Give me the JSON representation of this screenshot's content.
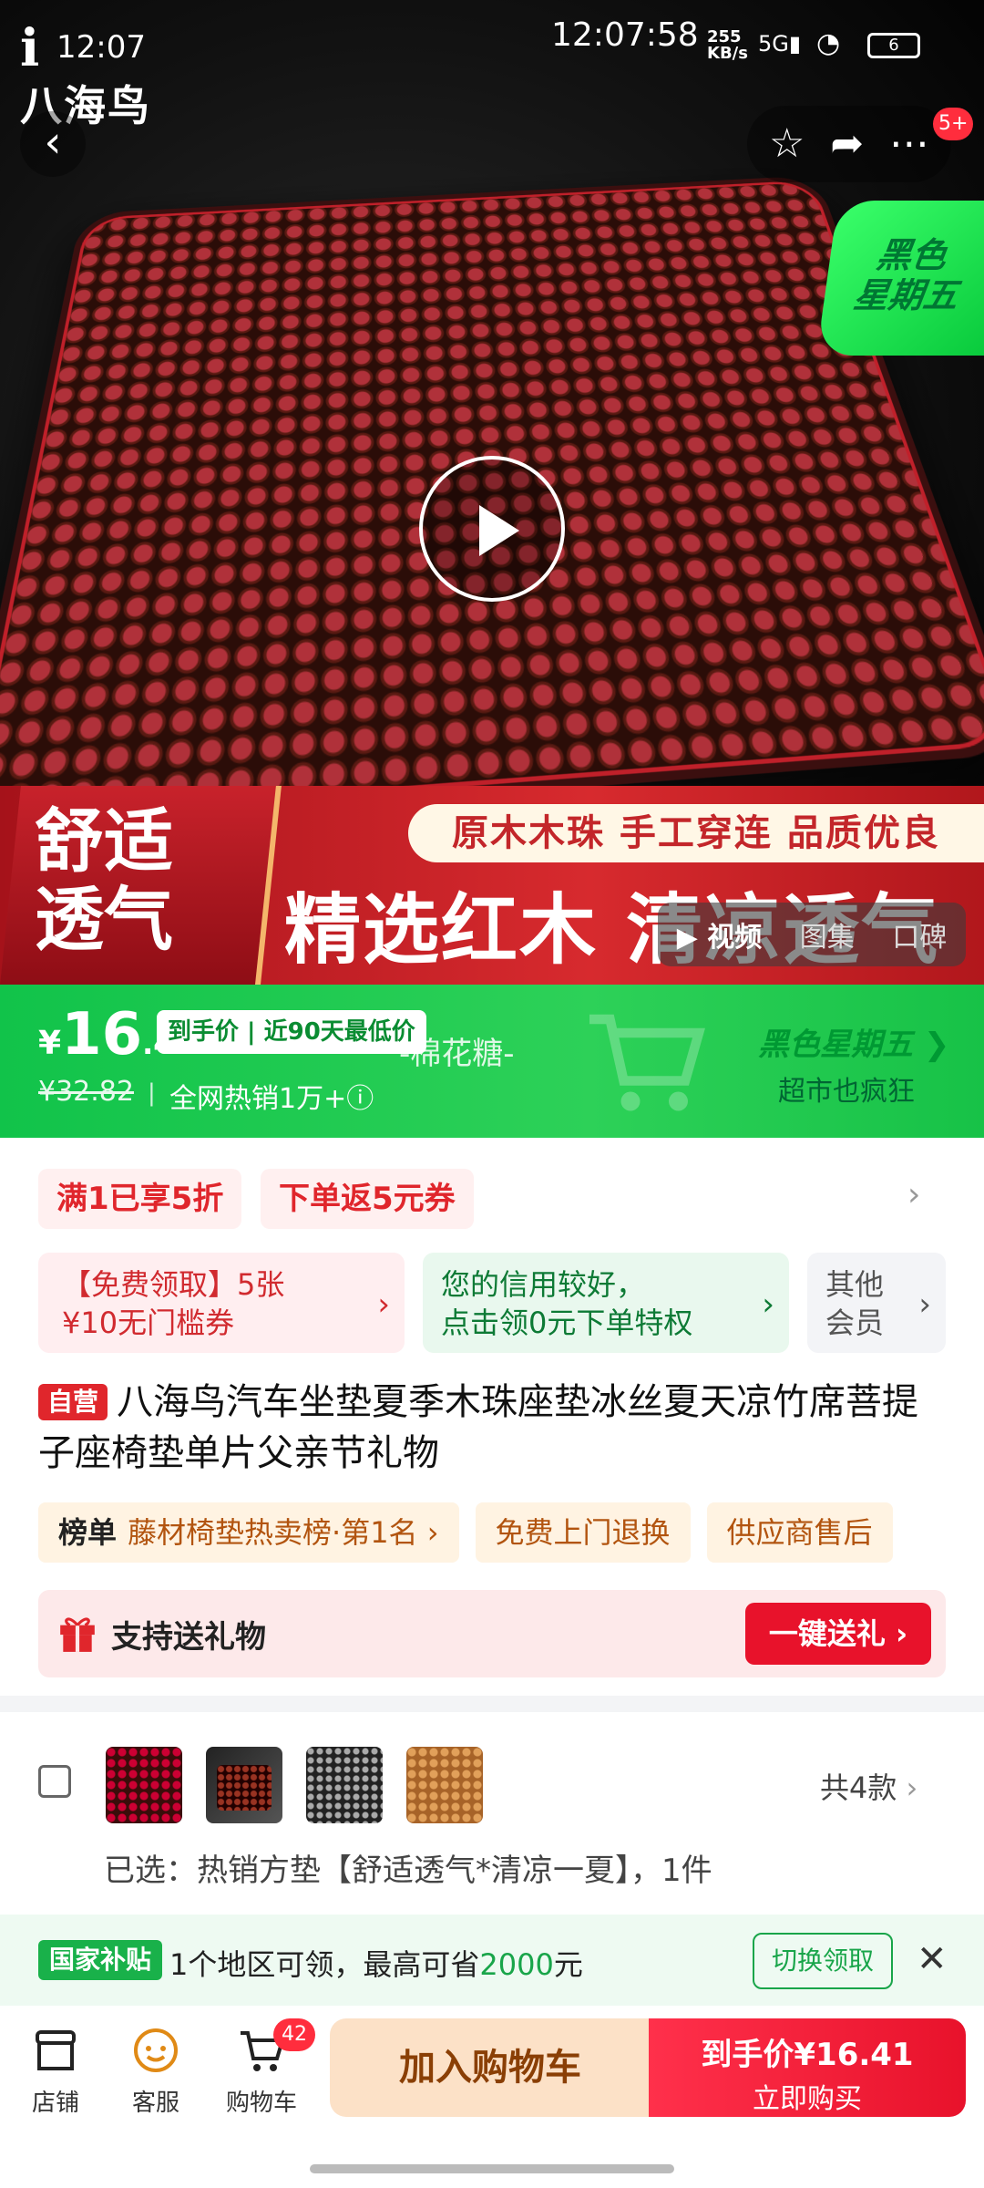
{
  "status_bar": {
    "time_left": "12:07",
    "time_center": "12:07:58",
    "network_speed": "255\nKB/s",
    "signal": "5G",
    "battery": "6"
  },
  "logo": {
    "mark": "i",
    "name": "八海鸟"
  },
  "top_actions": {
    "more_badge": "5+"
  },
  "hero": {
    "corner_promo": "黑色\n星期五",
    "promo_tag": "原木木珠 手工穿连 品质优良",
    "side_label": "舒适\n透气",
    "headline": "精选红木 清凉透气",
    "media_tabs": [
      "视频",
      "图集",
      "口碑"
    ]
  },
  "price_bar": {
    "currency": "¥",
    "price_int": "16",
    "price_dec": ".41",
    "lowest_pill": "到手价 | 近90天最低价",
    "watermark": "-棉花糖-",
    "original_price": "¥32.82",
    "separator": "|",
    "sold": "全网热销1万+ⓘ",
    "campaign_title": "黑色星期五 ❯",
    "campaign_sub": "超市也疯狂"
  },
  "coupons": [
    "满1已享5折",
    "下单返5元券"
  ],
  "cards": {
    "coupon_card": "【免费领取】5张\n¥10无门槛券",
    "credit_card": "您的信用较好，\n点击领0元下单特权",
    "member_card": "其他\n会员"
  },
  "product": {
    "badge": "自营",
    "title": "八海鸟汽车坐垫夏季木珠座垫冰丝夏天凉竹席菩提子座椅垫单片父亲节礼物"
  },
  "tags": {
    "rank_label": "榜单",
    "rank_text": "藤材椅垫热卖榜·第1名 ›",
    "return_free": "免费上门退换",
    "supplier": "供应商售后"
  },
  "gift": {
    "text": "支持送礼物",
    "button": "一键送礼 ›"
  },
  "sku": {
    "count": "共4款",
    "selected": "已选：热销方垫【舒适透气*清凉一夏】，1件"
  },
  "subsidy": {
    "badge": "国家补贴",
    "message_prefix": "1个地区可领，最高可省",
    "amount": "2000",
    "message_suffix": "元",
    "switch": "切换领取",
    "close": "✕"
  },
  "bottom_bar": {
    "store": "店铺",
    "service": "客服",
    "cart": "购物车",
    "cart_count": "42",
    "add_to_cart": "加入购物车",
    "buy_price": "到手价¥16.41",
    "buy_now": "立即购买"
  },
  "colors": {
    "primary_red": "#e8122b",
    "green": "#11c34a",
    "add_cart_bg": "#fce1c7"
  }
}
